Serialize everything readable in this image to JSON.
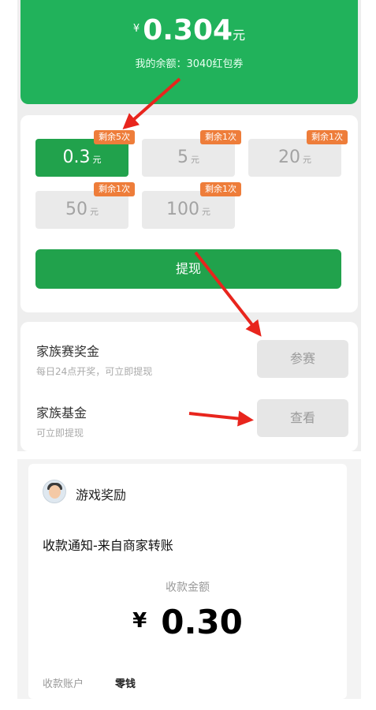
{
  "balance": {
    "currency": "¥",
    "amount": "0.304",
    "unit": "元",
    "line": "我的余额：3040红包券"
  },
  "options": [
    {
      "value": "0.3",
      "unit": "元",
      "tag": "剩余5次",
      "selected": true
    },
    {
      "value": "5",
      "unit": "元",
      "tag": "剩余1次",
      "selected": false
    },
    {
      "value": "20",
      "unit": "元",
      "tag": "剩余1次",
      "selected": false
    },
    {
      "value": "50",
      "unit": "元",
      "tag": "剩余1次",
      "selected": false
    },
    {
      "value": "100",
      "unit": "元",
      "tag": "剩余1次",
      "selected": false
    }
  ],
  "withdraw_button": "提现",
  "rewards": [
    {
      "title": "家族赛奖金",
      "subtitle": "每日24点开奖，可立即提现",
      "button": "参赛"
    },
    {
      "title": "家族基金",
      "subtitle": "可立即提现",
      "button": "查看"
    }
  ],
  "notification": {
    "app_name": "游戏奖励",
    "title": "收款通知-来自商家转账",
    "amount_label": "收款金额",
    "currency": "¥",
    "amount": "0.30",
    "account_label": "收款账户",
    "account_value": "零钱"
  },
  "colors": {
    "accent_green": "#21b25b",
    "tag_orange": "#ee7d3a",
    "arrow_red": "#e8251d"
  }
}
